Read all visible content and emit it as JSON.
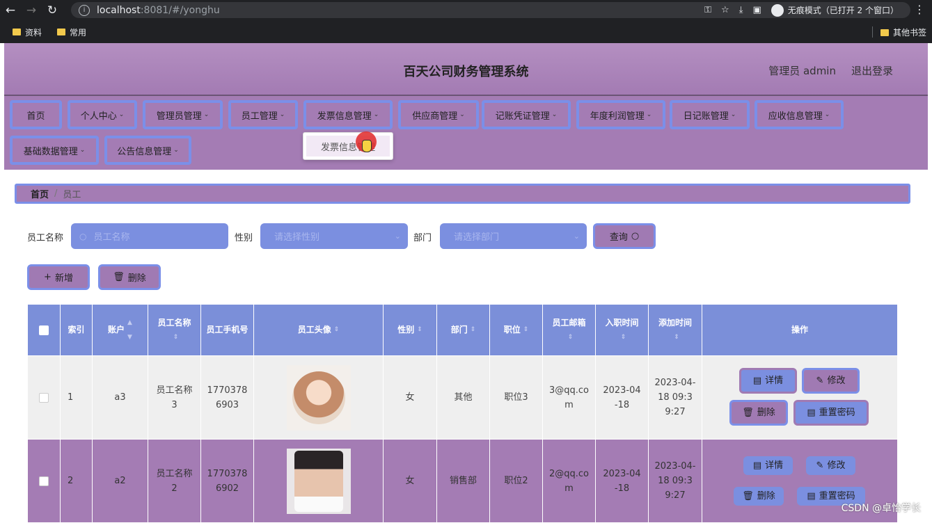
{
  "browser": {
    "url_host": "localhost",
    "url_rest": ":8081/#/yonghu",
    "incognito_label": "无痕模式（已打开 2 个窗口）",
    "bookmarks": [
      "资料",
      "常用"
    ],
    "other_bookmarks": "其他书签"
  },
  "header": {
    "title": "百天公司财务管理系统",
    "user": "管理员 admin",
    "logout": "退出登录"
  },
  "nav": {
    "items": [
      {
        "label": "首页",
        "chevron": false
      },
      {
        "label": "个人中心",
        "chevron": true
      },
      {
        "label": "管理员管理",
        "chevron": true
      },
      {
        "label": "员工管理",
        "chevron": true
      },
      {
        "label": "发票信息管理",
        "chevron": true
      },
      {
        "label": "供应商管理",
        "chevron": true
      },
      {
        "label": "记账凭证管理",
        "chevron": true
      },
      {
        "label": "年度利润管理",
        "chevron": true
      },
      {
        "label": "日记账管理",
        "chevron": true
      },
      {
        "label": "应收信息管理",
        "chevron": true
      },
      {
        "label": "基础数据管理",
        "chevron": true
      },
      {
        "label": "公告信息管理",
        "chevron": true
      }
    ],
    "dropdown_item": "发票信息管理"
  },
  "breadcrumb": {
    "home": "首页",
    "sep": "/",
    "current": "员工"
  },
  "filters": {
    "name_label": "员工名称",
    "name_placeholder": "员工名称",
    "gender_label": "性别",
    "gender_placeholder": "请选择性别",
    "dept_label": "部门",
    "dept_placeholder": "请选择部门",
    "query_button": "查询"
  },
  "toolbar": {
    "add": "新增",
    "delete": "删除"
  },
  "table": {
    "headers": [
      "索引",
      "账户",
      "员工名称",
      "员工手机号",
      "员工头像",
      "性别",
      "部门",
      "职位",
      "员工邮箱",
      "入职时间",
      "添加时间",
      "操作"
    ],
    "rows": [
      {
        "index": "1",
        "account": "a3",
        "name": "员工名称3",
        "phone": "17703786903",
        "gender": "女",
        "dept": "其他",
        "position": "职位3",
        "email": "3@qq.com",
        "join": "2023-04-18",
        "added": "2023-04-18 09:39:27"
      },
      {
        "index": "2",
        "account": "a2",
        "name": "员工名称2",
        "phone": "17703786902",
        "gender": "女",
        "dept": "销售部",
        "position": "职位2",
        "email": "2@qq.com",
        "join": "2023-04-18",
        "added": "2023-04-18 09:39:27"
      }
    ],
    "actions": {
      "detail": "详情",
      "edit": "修改",
      "delete": "删除",
      "reset": "重置密码"
    }
  },
  "watermark": "CSDN @卓怡学长",
  "colors": {
    "purple": "#a47cb4",
    "blue": "#7b8fe0",
    "border_blue": "#7b8fe8"
  }
}
